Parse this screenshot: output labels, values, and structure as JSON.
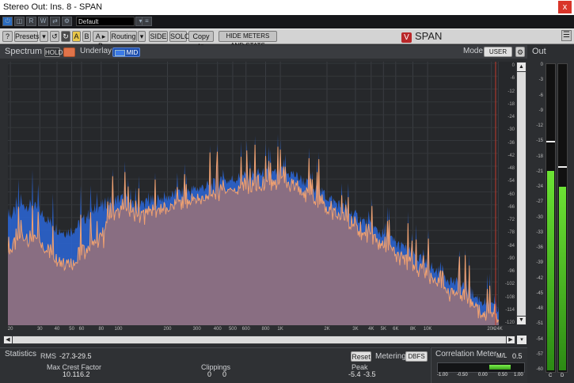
{
  "window": {
    "title": "Stereo Out: Ins. 8 - SPAN",
    "close_glyph": "x"
  },
  "host_bar": {
    "preset_value": "Default"
  },
  "toolbar": {
    "help": "?",
    "presets": "Presets",
    "a_label": "A",
    "b_label": "B",
    "ab_copy": "A ▸ B",
    "routing": "Routing",
    "side": "SIDE",
    "solo": "SOLO",
    "copy_to": "Copy to",
    "hide_meters": "HIDE METERS AND STATS",
    "brand": "SPAN",
    "brand_logo": "V"
  },
  "spectrum_panel": {
    "title": "Spectrum",
    "hold": "HOLD",
    "underlay": "Underlay",
    "mid": "MID",
    "mode_label": "Mode",
    "mode_value": "USER"
  },
  "y_ticks": [
    "0",
    "-6",
    "-12",
    "-18",
    "-24",
    "-30",
    "-36",
    "-42",
    "-48",
    "-54",
    "-60",
    "-66",
    "-72",
    "-78",
    "-84",
    "-90",
    "-96",
    "-102",
    "-108",
    "-114",
    "-120"
  ],
  "x_ticks": [
    "20",
    "30",
    "40",
    "50",
    "60",
    "80",
    "100",
    "200",
    "300",
    "400",
    "500",
    "600",
    "800",
    "1K",
    "2K",
    "3K",
    "4K",
    "5K",
    "6K",
    "8K",
    "10K",
    "20K",
    "24K"
  ],
  "statistics": {
    "title": "Statistics",
    "rms_label": "RMS",
    "rms_l": "-27.3",
    "rms_r": "-29.5",
    "crest_label": "Max Crest Factor",
    "crest_l": "10.1",
    "crest_r": "16.2",
    "clip_label": "Clippings",
    "clip_l": "0",
    "clip_r": "0",
    "peak_label": "Peak",
    "peak_l": "-5.4",
    "peak_r": "-3.5",
    "reset": "Reset",
    "metering_label": "Metering",
    "metering_value": "DBFS"
  },
  "correlation": {
    "title": "Correlation Meter",
    "mode": "M/L",
    "value": "0.5",
    "scale": [
      "-1.00",
      "-0.50",
      "0.00",
      "0.50",
      "1.00"
    ]
  },
  "out_meter": {
    "title": "Out",
    "scale": [
      "0",
      "-3",
      "-6",
      "-9",
      "-12",
      "-15",
      "-18",
      "-21",
      "-24",
      "-27",
      "-30",
      "-33",
      "-36",
      "-39",
      "-42",
      "-45",
      "-48",
      "-51",
      "-54",
      "-57",
      "-60"
    ],
    "left_label": "C",
    "right_label": "D",
    "left_level_db": -21,
    "right_level_db": -24,
    "left_peak_db": -15,
    "right_peak_db": -20
  },
  "colors": {
    "blue_series": "#2c66d8",
    "orange_series": "#f0a170",
    "fill": "#8e6f7e",
    "marker": "#c23a2c",
    "meter_green": "#5fd52b"
  }
}
